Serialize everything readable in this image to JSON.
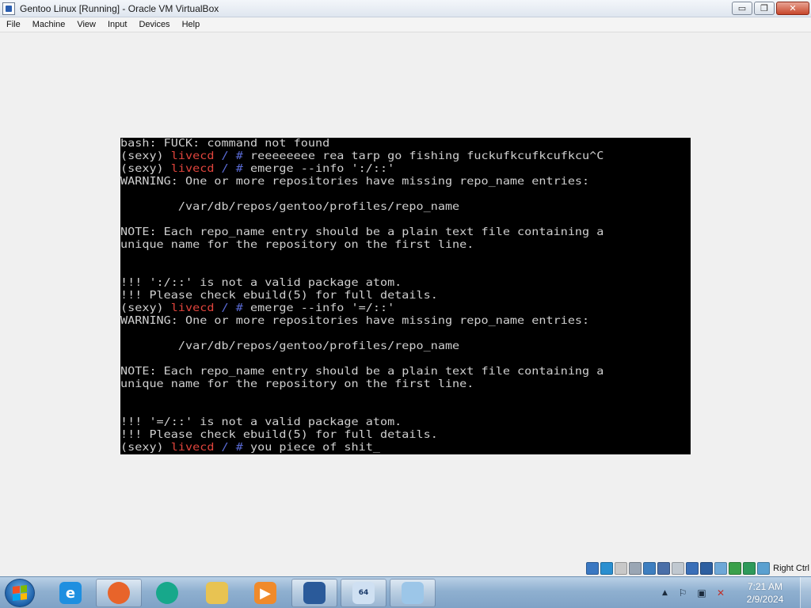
{
  "window": {
    "title": "Gentoo Linux [Running] - Oracle VM VirtualBox",
    "controls": {
      "minimize": "▭",
      "restore": "❐",
      "close": "✕"
    }
  },
  "menu": [
    "File",
    "Machine",
    "View",
    "Input",
    "Devices",
    "Help"
  ],
  "terminal": {
    "lines": [
      [
        {
          "t": "bash: FUCK: command not found"
        }
      ],
      [
        {
          "t": "(sexy) "
        },
        {
          "t": "livecd",
          "c": "host"
        },
        {
          "t": " / # ",
          "c": "sym"
        },
        {
          "t": "reeeeeeee rea tarp go fishing fuckufkcufkcufkcu^C"
        }
      ],
      [
        {
          "t": "(sexy) "
        },
        {
          "t": "livecd",
          "c": "host"
        },
        {
          "t": " / # ",
          "c": "sym"
        },
        {
          "t": "emerge --info ':/::'"
        }
      ],
      [
        {
          "t": "WARNING: One or more repositories have missing repo_name entries:"
        }
      ],
      [
        {
          "t": ""
        }
      ],
      [
        {
          "t": "        /var/db/repos/gentoo/profiles/repo_name"
        }
      ],
      [
        {
          "t": ""
        }
      ],
      [
        {
          "t": "NOTE: Each repo_name entry should be a plain text file containing a"
        }
      ],
      [
        {
          "t": "unique name for the repository on the first line."
        }
      ],
      [
        {
          "t": ""
        }
      ],
      [
        {
          "t": ""
        }
      ],
      [
        {
          "t": "!!! ':/::' is not a valid package atom."
        }
      ],
      [
        {
          "t": "!!! Please check ebuild(5) for full details."
        }
      ],
      [
        {
          "t": "(sexy) "
        },
        {
          "t": "livecd",
          "c": "host"
        },
        {
          "t": " / # ",
          "c": "sym"
        },
        {
          "t": "emerge --info '=/::'"
        }
      ],
      [
        {
          "t": "WARNING: One or more repositories have missing repo_name entries:"
        }
      ],
      [
        {
          "t": ""
        }
      ],
      [
        {
          "t": "        /var/db/repos/gentoo/profiles/repo_name"
        }
      ],
      [
        {
          "t": ""
        }
      ],
      [
        {
          "t": "NOTE: Each repo_name entry should be a plain text file containing a"
        }
      ],
      [
        {
          "t": "unique name for the repository on the first line."
        }
      ],
      [
        {
          "t": ""
        }
      ],
      [
        {
          "t": ""
        }
      ],
      [
        {
          "t": "!!! '=/::' is not a valid package atom."
        }
      ],
      [
        {
          "t": "!!! Please check ebuild(5) for full details."
        }
      ],
      [
        {
          "t": "(sexy) "
        },
        {
          "t": "livecd",
          "c": "host"
        },
        {
          "t": " / # ",
          "c": "sym"
        },
        {
          "t": "you piece of shit"
        },
        {
          "t": "_",
          "c": "cursor"
        }
      ]
    ]
  },
  "statusbar": {
    "icons": [
      "hard-disk-icon",
      "optical-drive-icon",
      "floppy-icon",
      "audio-icon",
      "network-icon",
      "usb-icon",
      "shared-folders-icon",
      "display-icon",
      "video-capture-icon",
      "recording-icon",
      "cpu-icon",
      "mouse-integration-icon",
      "host-key-icon"
    ],
    "host_key": "Right Ctrl"
  },
  "taskbar": {
    "apps": [
      {
        "name": "internet-explorer",
        "glyph": "e",
        "color": "#1e8fe0",
        "active": false
      },
      {
        "name": "firefox",
        "glyph": "",
        "color": "#e8642a",
        "active": true
      },
      {
        "name": "chat-app",
        "glyph": "",
        "color": "#17a88b",
        "active": false
      },
      {
        "name": "file-explorer",
        "glyph": "",
        "color": "#e8c352",
        "active": false
      },
      {
        "name": "media-player",
        "glyph": "▶",
        "color": "#f08a2a",
        "active": false
      },
      {
        "name": "virtualbox",
        "glyph": "",
        "color": "#2a5a9a",
        "active": true
      },
      {
        "name": "virtualbox-vm",
        "glyph": "64",
        "color": "#cfe0f2",
        "active": true
      },
      {
        "name": "notepad",
        "glyph": "",
        "color": "#9cc6e8",
        "active": true
      }
    ],
    "tray": {
      "arrow": "▲",
      "icons": [
        "⚐",
        "▣",
        "✕"
      ],
      "time": "7:21 AM",
      "date": "2/9/2024"
    }
  }
}
